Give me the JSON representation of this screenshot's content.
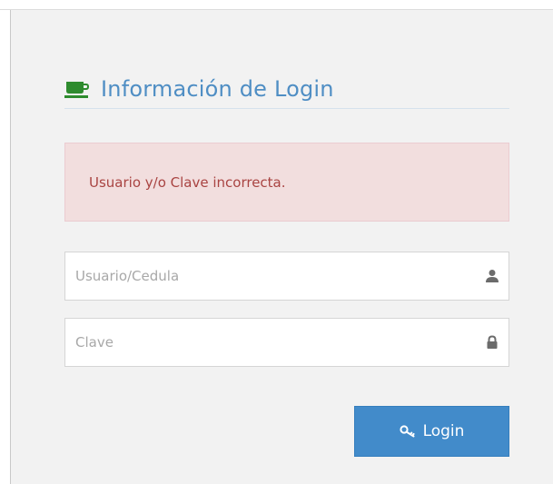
{
  "header": {
    "title": "Información de Login",
    "icon": "coffee-cup-icon"
  },
  "alert": {
    "message": "Usuario y/o Clave incorrecta."
  },
  "form": {
    "username": {
      "placeholder": "Usuario/Cedula",
      "value": "",
      "icon": "user-icon"
    },
    "password": {
      "placeholder": "Clave",
      "value": "",
      "icon": "lock-icon"
    },
    "submit": {
      "label": "Login",
      "icon": "key-icon"
    }
  },
  "colors": {
    "accent": "#4f8ec4",
    "button": "#428bca",
    "alert_bg": "#f2dede",
    "alert_text": "#a94442",
    "icon_green": "#2e8b2e"
  }
}
